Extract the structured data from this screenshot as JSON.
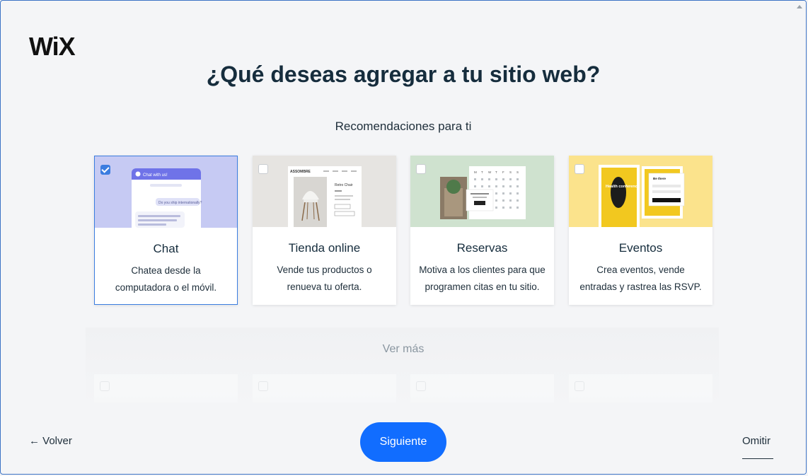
{
  "brand": {
    "logo": "WiX"
  },
  "header": {
    "title": "¿Qué deseas agregar a tu sitio web?",
    "subtitle": "Recomendaciones para ti"
  },
  "cards": [
    {
      "name": "Chat",
      "desc1": "Chatea desde la",
      "desc2": "computadora o el móvil.",
      "selected": true,
      "thumb": {
        "header": "Chat with us!",
        "msg1": "Do you ship internationally?"
      }
    },
    {
      "name": "Tienda online",
      "desc1": "Vende tus productos o",
      "desc2": "renueva tu oferta.",
      "selected": false,
      "thumb": {
        "brand": "ASSOMBRE",
        "product": "Retro Chair"
      }
    },
    {
      "name": "Reservas",
      "desc1": "Motiva a los clientes para que",
      "desc2": "programen citas en tu sitio.",
      "selected": false,
      "thumb": {
        "days": [
          "M",
          "T",
          "W",
          "T",
          "F",
          "S",
          "S"
        ]
      }
    },
    {
      "name": "Eventos",
      "desc1": "Crea eventos, vende",
      "desc2": "entradas y rastrea las RSVP.",
      "selected": false,
      "thumb": {
        "poster": "Health conference",
        "form": "Be there"
      }
    }
  ],
  "more": {
    "label": "Ver más"
  },
  "footer": {
    "back": "← Volver",
    "next": "Siguiente",
    "skip": "Omitir"
  },
  "colors": {
    "accent": "#116dff",
    "selected_border": "#3b7de0",
    "chat_bg": "#c6caf3",
    "store_bg": "#e6e4e1",
    "booking_bg": "#cfe2cf",
    "events_bg": "#fbe38c"
  }
}
